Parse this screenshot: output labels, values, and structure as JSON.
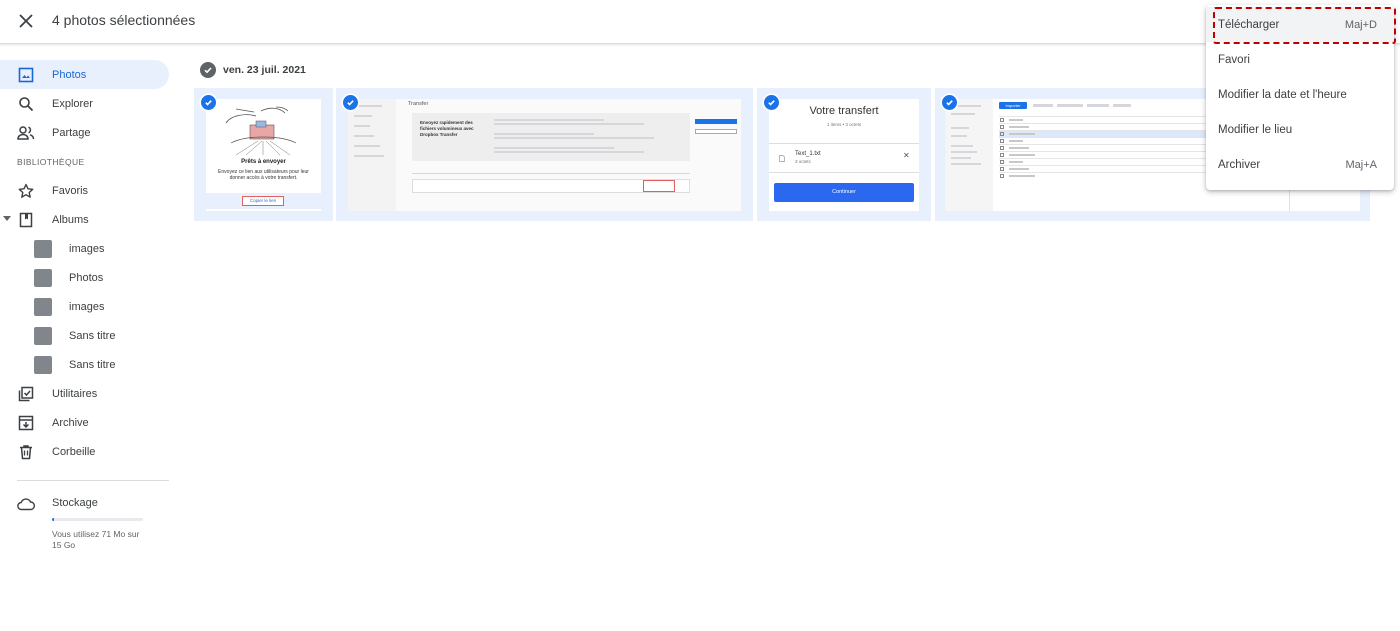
{
  "header": {
    "selection_title": "4 photos sélectionnées"
  },
  "sidebar": {
    "items": [
      {
        "label": "Photos",
        "icon": "photo-icon",
        "active": true
      },
      {
        "label": "Explorer",
        "icon": "search-icon"
      },
      {
        "label": "Partage",
        "icon": "people-icon"
      }
    ],
    "library_label": "BIBLIOTHÈQUE",
    "library_items": [
      {
        "label": "Favoris",
        "icon": "star-icon"
      },
      {
        "label": "Albums",
        "icon": "album-icon"
      }
    ],
    "albums": [
      {
        "label": "images"
      },
      {
        "label": "Photos"
      },
      {
        "label": "images"
      },
      {
        "label": "Sans titre"
      },
      {
        "label": "Sans titre"
      }
    ],
    "bottom_items": [
      {
        "label": "Utilitaires",
        "icon": "utilities-icon"
      },
      {
        "label": "Archive",
        "icon": "archive-icon"
      },
      {
        "label": "Corbeille",
        "icon": "trash-icon"
      }
    ],
    "storage": {
      "label": "Stockage",
      "usage_text": "Vous utilisez 71 Mo sur 15 Go",
      "used_fraction": 0.005
    }
  },
  "main": {
    "date_label": "ven. 23 juil. 2021",
    "photos": {
      "p1": {
        "title": "Prêts à envoyer",
        "text": "Envoyez ce lien aux utilisateurs pour leur donner accès à votre transfert.",
        "button": "Copier le lien"
      },
      "p2": {
        "heading": "Transfer",
        "body": "Envoyez rapidement des fichiers volumineux avec Dropbox Transfer"
      },
      "p3": {
        "title": "Votre transfert",
        "subtitle": "1 items • 3 octets",
        "file": "Text_1.txt",
        "file_size": "3 octets",
        "button": "Continuer"
      },
      "p4": {
        "button": "Importer"
      }
    }
  },
  "menu": {
    "items": [
      {
        "label": "Télécharger",
        "shortcut": "Maj+D"
      },
      {
        "label": "Favori",
        "shortcut": ""
      },
      {
        "label": "Modifier la date et l'heure",
        "shortcut": ""
      },
      {
        "label": "Modifier le lieu",
        "shortcut": ""
      },
      {
        "label": "Archiver",
        "shortcut": "Maj+A"
      }
    ]
  },
  "colors": {
    "accent": "#1a73e8",
    "selection_bg": "#e8f0fe",
    "highlight_dash": "#c00000"
  }
}
